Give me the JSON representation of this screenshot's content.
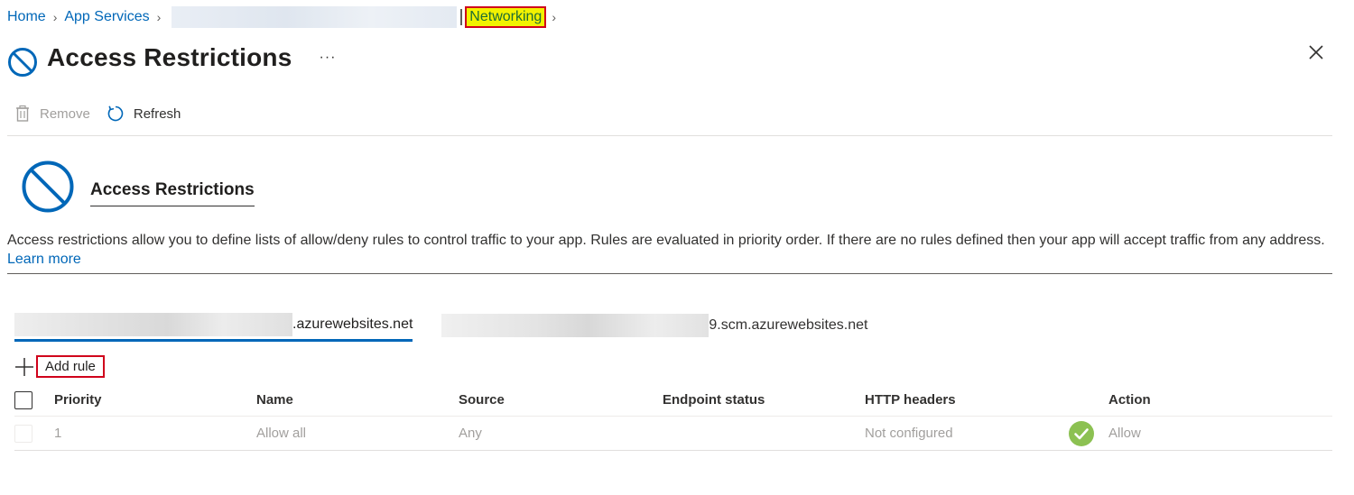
{
  "breadcrumb": {
    "home": "Home",
    "app_services": "App Services",
    "current": "Networking"
  },
  "header": {
    "title": "Access Restrictions",
    "more": "···"
  },
  "toolbar": {
    "remove_label": "Remove",
    "refresh_label": "Refresh"
  },
  "section": {
    "heading": "Access Restrictions",
    "description": "Access restrictions allow you to define lists of allow/deny rules to control traffic to your app. Rules are evaluated in priority order. If there are no rules defined then your app will accept traffic from any address.",
    "learn_more": "Learn more"
  },
  "tabs": [
    {
      "suffix": ".azurewebsites.net"
    },
    {
      "suffix": "9.scm.azurewebsites.net"
    }
  ],
  "add_rule_label": "Add rule",
  "table": {
    "columns": [
      "Priority",
      "Name",
      "Source",
      "Endpoint status",
      "HTTP headers",
      "Action"
    ],
    "rows": [
      {
        "priority": "1",
        "name": "Allow all",
        "source": "Any",
        "endpoint_status": "",
        "http_headers": "Not configured",
        "action": "Allow"
      }
    ]
  },
  "colors": {
    "accent": "#0067b8",
    "highlight": "#f2f200",
    "annotation_border": "#d0021b",
    "status_ok": "#8cc152"
  },
  "icons": {
    "blocked": "no-entry-icon",
    "close": "close-icon",
    "remove": "trash-icon",
    "refresh": "refresh-icon",
    "add": "plus-icon",
    "status": "checkmark-circle-icon"
  }
}
